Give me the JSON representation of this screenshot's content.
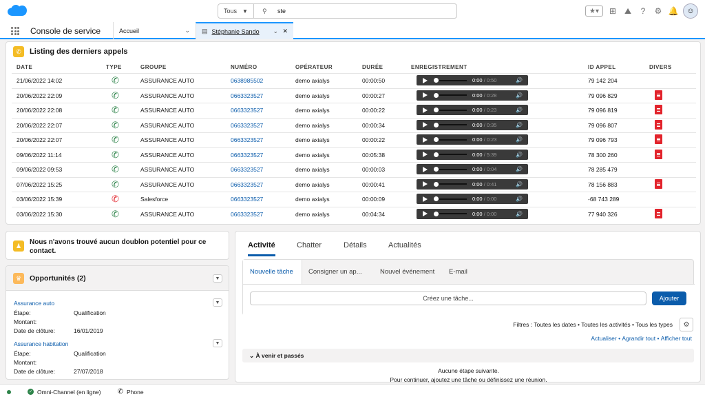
{
  "search": {
    "scope": "Tous",
    "query": "ste"
  },
  "nav": {
    "app_name": "Console de service",
    "home_tab": "Accueil",
    "record_tab": "Stéphanie Sando"
  },
  "calls": {
    "title": "Listing des derniers appels",
    "headers": [
      "DATE",
      "TYPE",
      "GROUPE",
      "NUMÉRO",
      "OPÉRATEUR",
      "DURÉE",
      "ENREGISTREMENT",
      "ID APPEL",
      "DIVERS"
    ],
    "rows": [
      {
        "date": "21/06/2022 14:02",
        "type": "inbound",
        "groupe": "ASSURANCE AUTO",
        "numero": "0638985502",
        "operateur": "demo axialys",
        "duree": "00:00:50",
        "pos": "0:00",
        "len": "0:50",
        "id": "79 142 204",
        "divers": false
      },
      {
        "date": "20/06/2022 22:09",
        "type": "inbound",
        "groupe": "ASSURANCE AUTO",
        "numero": "0663323527",
        "operateur": "demo axialys",
        "duree": "00:00:27",
        "pos": "0:00",
        "len": "0:28",
        "id": "79 096 829",
        "divers": true
      },
      {
        "date": "20/06/2022 22:08",
        "type": "inbound",
        "groupe": "ASSURANCE AUTO",
        "numero": "0663323527",
        "operateur": "demo axialys",
        "duree": "00:00:22",
        "pos": "0:00",
        "len": "0:23",
        "id": "79 096 819",
        "divers": true
      },
      {
        "date": "20/06/2022 22:07",
        "type": "inbound",
        "groupe": "ASSURANCE AUTO",
        "numero": "0663323527",
        "operateur": "demo axialys",
        "duree": "00:00:34",
        "pos": "0:00",
        "len": "0:35",
        "id": "79 096 807",
        "divers": true
      },
      {
        "date": "20/06/2022 22:07",
        "type": "inbound",
        "groupe": "ASSURANCE AUTO",
        "numero": "0663323527",
        "operateur": "demo axialys",
        "duree": "00:00:22",
        "pos": "0:00",
        "len": "0:23",
        "id": "79 096 793",
        "divers": true
      },
      {
        "date": "09/06/2022 11:14",
        "type": "inbound",
        "groupe": "ASSURANCE AUTO",
        "numero": "0663323527",
        "operateur": "demo axialys",
        "duree": "00:05:38",
        "pos": "0:00",
        "len": "5:39",
        "id": "78 300 260",
        "divers": true
      },
      {
        "date": "09/06/2022 09:53",
        "type": "inbound",
        "groupe": "ASSURANCE AUTO",
        "numero": "0663323527",
        "operateur": "demo axialys",
        "duree": "00:00:03",
        "pos": "0:00",
        "len": "0:04",
        "id": "78 285 479",
        "divers": false
      },
      {
        "date": "07/06/2022 15:25",
        "type": "inbound",
        "groupe": "ASSURANCE AUTO",
        "numero": "0663323527",
        "operateur": "demo axialys",
        "duree": "00:00:41",
        "pos": "0:00",
        "len": "0:41",
        "id": "78 156 883",
        "divers": true
      },
      {
        "date": "03/06/2022 15:39",
        "type": "missed",
        "groupe": "Salesforce",
        "numero": "0663323527",
        "operateur": "demo axialys",
        "duree": "00:00:09",
        "pos": "0:00",
        "len": "0:00",
        "id": "-68 743 289",
        "divers": false
      },
      {
        "date": "03/06/2022 15:30",
        "type": "inbound",
        "groupe": "ASSURANCE AUTO",
        "numero": "0663323527",
        "operateur": "demo axialys",
        "duree": "00:04:34",
        "pos": "0:00",
        "len": "0:00",
        "id": "77 940 326",
        "divers": true
      }
    ]
  },
  "duplicates": {
    "message": "Nous n'avons trouvé aucun doublon potentiel pour ce contact."
  },
  "opportunities": {
    "title": "Opportunités (2)",
    "items": [
      {
        "name": "Assurance auto",
        "etape_label": "Étape:",
        "etape": "Qualification",
        "montant_label": "Montant:",
        "cloture_label": "Date de clôture:",
        "cloture": "16/01/2019"
      },
      {
        "name": "Assurance habitation",
        "etape_label": "Étape:",
        "etape": "Qualification",
        "montant_label": "Montant:",
        "cloture_label": "Date de clôture:",
        "cloture": "27/07/2018"
      }
    ]
  },
  "activity": {
    "tabs": [
      "Activité",
      "Chatter",
      "Détails",
      "Actualités"
    ],
    "subtabs": [
      "Nouvelle tâche",
      "Consigner un ap...",
      "Nouvel événement",
      "E-mail"
    ],
    "task_placeholder": "Créez une tâche...",
    "add_button": "Ajouter",
    "filters": "Filtres : Toutes les dates • Toutes les activités • Tous les types",
    "links": [
      "Actualiser",
      "Agrandir tout",
      "Afficher tout"
    ],
    "link_sep": " • ",
    "upcoming": "À venir et passés",
    "no_step": "Aucune étape suivante.",
    "hint": "Pour continuer, ajoutez une tâche ou définissez une réunion."
  },
  "utility": {
    "omni": "Omni-Channel (en ligne)",
    "phone": "Phone"
  },
  "colors": {
    "accent": "#0b5cab",
    "call_in": "#2e844a",
    "call_missed": "#e2242c",
    "pdf": "#e2242c"
  }
}
